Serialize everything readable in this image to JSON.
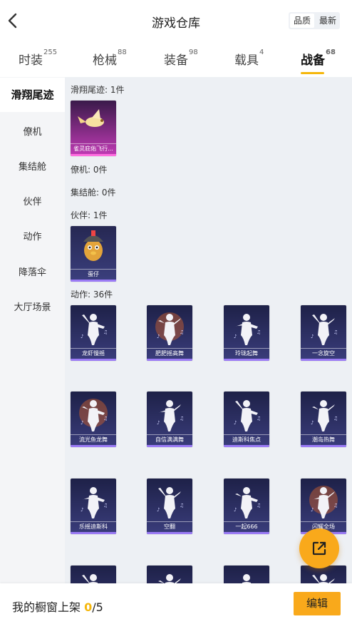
{
  "header": {
    "title": "游戏仓库",
    "sort_options": [
      "品质",
      "最新"
    ],
    "active_sort": "品质"
  },
  "tabs": [
    {
      "label": "时装",
      "count": "255"
    },
    {
      "label": "枪械",
      "count": "88"
    },
    {
      "label": "装备",
      "count": "98"
    },
    {
      "label": "载具",
      "count": "4"
    },
    {
      "label": "战备",
      "count": "68",
      "active": true
    }
  ],
  "sidebar": {
    "items": [
      "滑翔尾迹",
      "僚机",
      "集结舱",
      "伙伴",
      "动作",
      "降落伞",
      "大厅场景"
    ],
    "active": "滑翔尾迹"
  },
  "sections": {
    "glide_trail": {
      "label": "滑翔尾迹: 1件",
      "items": [
        "雀灵庇佑飞行..."
      ]
    },
    "wingman": {
      "label": "僚机: 0件"
    },
    "capsule": {
      "label": "集结舱: 0件"
    },
    "partner": {
      "label": "伙伴: 1件",
      "items": [
        "蛋仔"
      ]
    },
    "emote": {
      "label": "动作: 36件",
      "items": [
        "龙虾慢摇",
        "肥肥摇高舞",
        "玲珑起舞",
        "一念旋空",
        "流光鱼龙舞",
        "自信满满舞",
        "迪斯科焦点",
        "潮岛热舞",
        "乐摇迪斯科",
        "空翻",
        "一起666",
        "闪耀全场",
        "",
        "",
        "",
        ""
      ]
    }
  },
  "bottom_bar": {
    "shelf_label": "我的橱窗上架",
    "shelf_count": "0",
    "shelf_total": "/5",
    "edit_label": "编辑"
  },
  "colors": {
    "accent": "#f9a91b",
    "tab_underline": "#f5b70c",
    "card_dark": "#2a2d5e",
    "card_pink": "#b02fa7"
  },
  "icons": [
    "back-arrow-icon",
    "share-external-icon"
  ]
}
